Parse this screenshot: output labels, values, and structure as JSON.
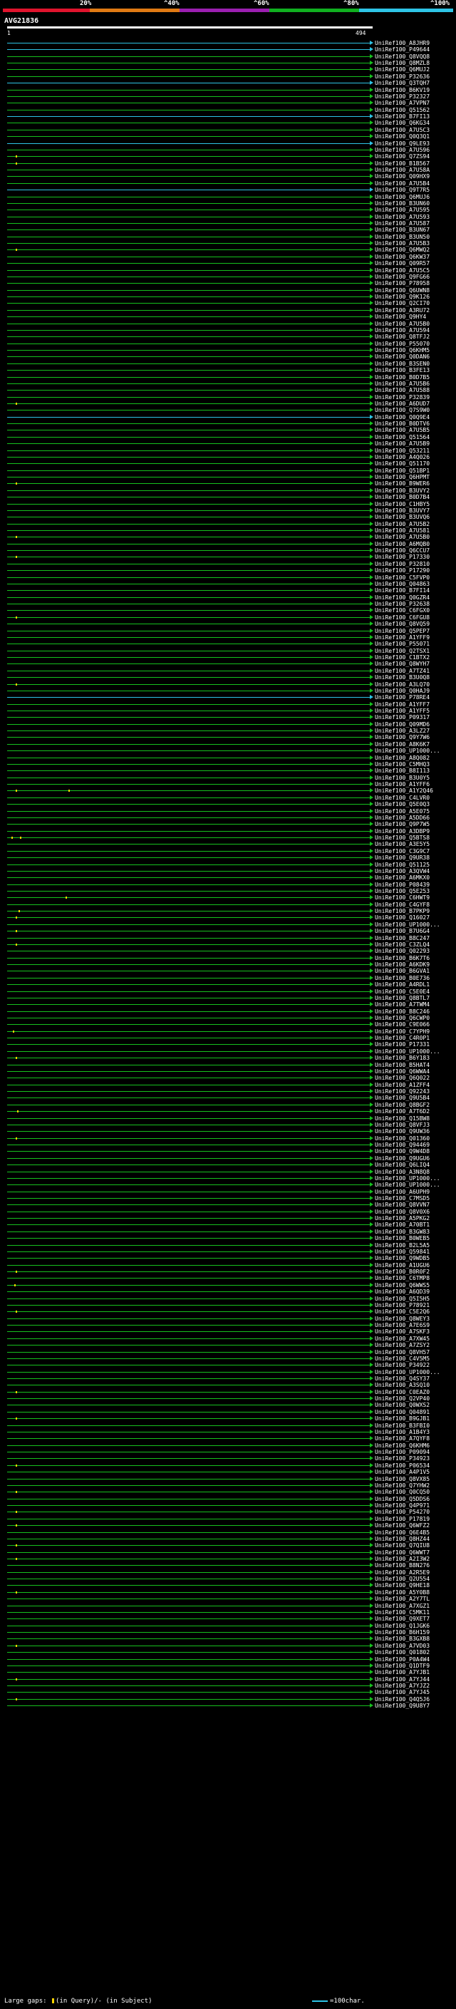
{
  "scale": {
    "labels": [
      "20%",
      "^40%",
      "^60%",
      "^80%",
      "^100%"
    ],
    "colors": [
      "#e0142d",
      "#e07a14",
      "#9b1fb0",
      "#10b020",
      "#2ec4e6"
    ]
  },
  "query": {
    "id": "AVG21836",
    "start": "1",
    "end": "494"
  },
  "colors": {
    "hit_green": "#16c01e",
    "hit_cyan": "#2ec4e6",
    "gap_yellow": "#ffd400"
  },
  "hits": [
    {
      "label": "UniRef100_A8JHR9",
      "color": "cyan"
    },
    {
      "label": "UniRef100_P49644",
      "color": "cyan"
    },
    {
      "label": "UniRef100_Q8VQQ8",
      "color": "green"
    },
    {
      "label": "UniRef100_Q8MZL8",
      "color": "green"
    },
    {
      "label": "UniRef100_Q6MUJ2",
      "color": "green"
    },
    {
      "label": "UniRef100_P32636",
      "color": "green"
    },
    {
      "label": "UniRef100_Q3TQH7",
      "color": "cyan"
    },
    {
      "label": "UniRef100_B6KV19",
      "color": "green"
    },
    {
      "label": "UniRef100_P32327",
      "color": "green"
    },
    {
      "label": "UniRef100_A7VPN7",
      "color": "green"
    },
    {
      "label": "UniRef100_Q51562",
      "color": "green"
    },
    {
      "label": "UniRef100_B7FI13",
      "color": "cyan"
    },
    {
      "label": "UniRef100_Q6KG34",
      "color": "green"
    },
    {
      "label": "UniRef100_A7U5C3",
      "color": "green"
    },
    {
      "label": "UniRef100_Q0Q3Q1",
      "color": "green"
    },
    {
      "label": "UniRef100_Q9LE93",
      "color": "cyan"
    },
    {
      "label": "UniRef100_A7U596",
      "color": "green"
    },
    {
      "label": "UniRef100_Q7ZS94",
      "color": "green"
    },
    {
      "label": "UniRef100_B1B567",
      "color": "green"
    },
    {
      "label": "UniRef100_A7U58A",
      "color": "green"
    },
    {
      "label": "UniRef100_Q09HX9",
      "color": "green"
    },
    {
      "label": "UniRef100_A7U5B4",
      "color": "green"
    },
    {
      "label": "UniRef100_Q9T7R5",
      "color": "cyan"
    },
    {
      "label": "UniRef100_Q6MUJ6",
      "color": "green"
    },
    {
      "label": "UniRef100_B3UN60",
      "color": "green"
    },
    {
      "label": "UniRef100_A7U595",
      "color": "green"
    },
    {
      "label": "UniRef100_A7U593",
      "color": "green"
    },
    {
      "label": "UniRef100_A7U587",
      "color": "green"
    },
    {
      "label": "UniRef100_B3UN67",
      "color": "green"
    },
    {
      "label": "UniRef100_B3UN50",
      "color": "green"
    },
    {
      "label": "UniRef100_A7U5B3",
      "color": "green"
    },
    {
      "label": "UniRef100_Q6MWQ2",
      "color": "green"
    },
    {
      "label": "UniRef100_Q6KW37",
      "color": "green"
    },
    {
      "label": "UniRef100_Q09R57",
      "color": "green"
    },
    {
      "label": "UniRef100_A7U5C5",
      "color": "green"
    },
    {
      "label": "UniRef100_Q9FG66",
      "color": "green"
    },
    {
      "label": "UniRef100_P78958",
      "color": "green"
    },
    {
      "label": "UniRef100_Q6UWN8",
      "color": "green"
    },
    {
      "label": "UniRef100_Q9K126",
      "color": "green"
    },
    {
      "label": "UniRef100_Q2CI70",
      "color": "green"
    },
    {
      "label": "UniRef100_A3RU72",
      "color": "green"
    },
    {
      "label": "UniRef100_Q9HY4",
      "color": "green"
    },
    {
      "label": "UniRef100_A7U5B0",
      "color": "green"
    },
    {
      "label": "UniRef100_A7U594",
      "color": "green"
    },
    {
      "label": "UniRef100_Q8TFJ2",
      "color": "green"
    },
    {
      "label": "UniRef100_P55070",
      "color": "green"
    },
    {
      "label": "UniRef100_Q6KHM5",
      "color": "green"
    },
    {
      "label": "UniRef100_Q0DAN6",
      "color": "green"
    },
    {
      "label": "UniRef100_B3SEN0",
      "color": "green"
    },
    {
      "label": "UniRef100_B3FE13",
      "color": "green"
    },
    {
      "label": "UniRef100_B0D7B5",
      "color": "green"
    },
    {
      "label": "UniRef100_A7U5B6",
      "color": "green"
    },
    {
      "label": "UniRef100_A7U588",
      "color": "green"
    },
    {
      "label": "UniRef100_P32839",
      "color": "green"
    },
    {
      "label": "UniRef100_A6DUD7",
      "color": "green"
    },
    {
      "label": "UniRef100_Q7S9W0",
      "color": "green"
    },
    {
      "label": "UniRef100_Q0Q9E4",
      "color": "cyan"
    },
    {
      "label": "UniRef100_B0DTV6",
      "color": "green"
    },
    {
      "label": "UniRef100_A7U5B5",
      "color": "green"
    },
    {
      "label": "UniRef100_Q51564",
      "color": "green"
    },
    {
      "label": "UniRef100_A7U5B9",
      "color": "green"
    },
    {
      "label": "UniRef100_Q53211",
      "color": "green"
    },
    {
      "label": "UniRef100_A4Q026",
      "color": "green"
    },
    {
      "label": "UniRef100_Q51170",
      "color": "green"
    },
    {
      "label": "UniRef100_Q51BP1",
      "color": "green"
    },
    {
      "label": "UniRef100_Q6HPMT",
      "color": "green"
    },
    {
      "label": "UniRef100_B9WER6",
      "color": "green"
    },
    {
      "label": "UniRef100_B3UVY2",
      "color": "green"
    },
    {
      "label": "UniRef100_B0D7B4",
      "color": "green"
    },
    {
      "label": "UniRef100_C1HBY5",
      "color": "green"
    },
    {
      "label": "UniRef100_B3UVY7",
      "color": "green"
    },
    {
      "label": "UniRef100_B3UVQ6",
      "color": "green"
    },
    {
      "label": "UniRef100_A7U5B2",
      "color": "green"
    },
    {
      "label": "UniRef100_A7U581",
      "color": "green"
    },
    {
      "label": "UniRef100_A7U5B0",
      "color": "green"
    },
    {
      "label": "UniRef100_A6MQB0",
      "color": "green"
    },
    {
      "label": "UniRef100_Q6CCU7",
      "color": "green"
    },
    {
      "label": "UniRef100_P17330",
      "color": "green"
    },
    {
      "label": "UniRef100_P32810",
      "color": "green"
    },
    {
      "label": "UniRef100_P17290",
      "color": "green"
    },
    {
      "label": "UniRef100_C5FVP0",
      "color": "green"
    },
    {
      "label": "UniRef100_Q04863",
      "color": "green"
    },
    {
      "label": "UniRef100_B7FI14",
      "color": "green"
    },
    {
      "label": "UniRef100_Q0GZR4",
      "color": "green"
    },
    {
      "label": "UniRef100_P32638",
      "color": "green"
    },
    {
      "label": "UniRef100_C6FGX0",
      "color": "green"
    },
    {
      "label": "UniRef100_C6FGU8",
      "color": "green"
    },
    {
      "label": "UniRef100_Q8VQ59",
      "color": "green"
    },
    {
      "label": "UniRef100_Q5PEP7",
      "color": "green"
    },
    {
      "label": "UniRef100_A1YFF9",
      "color": "green"
    },
    {
      "label": "UniRef100_P55071",
      "color": "green"
    },
    {
      "label": "UniRef100_Q2TSX1",
      "color": "green"
    },
    {
      "label": "UniRef100_C1BTX2",
      "color": "green"
    },
    {
      "label": "UniRef100_Q8WYH7",
      "color": "green"
    },
    {
      "label": "UniRef100_A7TZ41",
      "color": "green"
    },
    {
      "label": "UniRef100_B3U0Q8",
      "color": "green"
    },
    {
      "label": "UniRef100_A3LQ70",
      "color": "green"
    },
    {
      "label": "UniRef100_Q0HAJ9",
      "color": "green"
    },
    {
      "label": "UniRef100_P78RE4",
      "color": "cyan"
    },
    {
      "label": "UniRef100_A1YFF7",
      "color": "green"
    },
    {
      "label": "UniRef100_A1YFF5",
      "color": "green"
    },
    {
      "label": "UniRef100_P09317",
      "color": "green"
    },
    {
      "label": "UniRef100_Q09MD6",
      "color": "green"
    },
    {
      "label": "UniRef100_A3LZ27",
      "color": "green"
    },
    {
      "label": "UniRef100_Q9Y7W6",
      "color": "green"
    },
    {
      "label": "UniRef100_A8K6K7",
      "color": "green"
    },
    {
      "label": "UniRef100_UP1000...",
      "color": "green"
    },
    {
      "label": "UniRef100_A8Q082",
      "color": "green"
    },
    {
      "label": "UniRef100_C5MHQ3",
      "color": "green"
    },
    {
      "label": "UniRef100_B8I113",
      "color": "green"
    },
    {
      "label": "UniRef100_B3U0Y5",
      "color": "green"
    },
    {
      "label": "UniRef100_A1YFF6",
      "color": "green"
    },
    {
      "label": "UniRef100_A1Y2Q46",
      "color": "green"
    },
    {
      "label": "UniRef100_C4LVR0",
      "color": "green"
    },
    {
      "label": "UniRef100_Q5E0Q3",
      "color": "green"
    },
    {
      "label": "UniRef100_A5E075",
      "color": "green"
    },
    {
      "label": "UniRef100_A5DD66",
      "color": "green"
    },
    {
      "label": "UniRef100_Q9P7W5",
      "color": "green"
    },
    {
      "label": "UniRef100_A3DBP9",
      "color": "green"
    },
    {
      "label": "UniRef100_Q5BTS8",
      "color": "green"
    },
    {
      "label": "UniRef100_A3E5Y5",
      "color": "green"
    },
    {
      "label": "UniRef100_C3G9C7",
      "color": "green"
    },
    {
      "label": "UniRef100_Q9UR38",
      "color": "green"
    },
    {
      "label": "UniRef100_Q51125",
      "color": "green"
    },
    {
      "label": "UniRef100_A3QVW4",
      "color": "green"
    },
    {
      "label": "UniRef100_A6MKX0",
      "color": "green"
    },
    {
      "label": "UniRef100_P08439",
      "color": "green"
    },
    {
      "label": "UniRef100_Q5E253",
      "color": "green"
    },
    {
      "label": "UniRef100_C6HWT9",
      "color": "green"
    },
    {
      "label": "UniRef100_C4GYF8",
      "color": "green"
    },
    {
      "label": "UniRef100_B7PKP9",
      "color": "green"
    },
    {
      "label": "UniRef100_Q16027",
      "color": "green"
    },
    {
      "label": "UniRef100_UP1000...",
      "color": "green"
    },
    {
      "label": "UniRef100_B7U6G4",
      "color": "green"
    },
    {
      "label": "UniRef100_B8C247",
      "color": "green"
    },
    {
      "label": "UniRef100_C3ZLQ4",
      "color": "green"
    },
    {
      "label": "UniRef100_Q02293",
      "color": "green"
    },
    {
      "label": "UniRef100_B6K7T6",
      "color": "green"
    },
    {
      "label": "UniRef100_A6KDK9",
      "color": "green"
    },
    {
      "label": "UniRef100_B6GVA1",
      "color": "green"
    },
    {
      "label": "UniRef100_B0E736",
      "color": "green"
    },
    {
      "label": "UniRef100_A4RDL1",
      "color": "green"
    },
    {
      "label": "UniRef100_C5E0E4",
      "color": "green"
    },
    {
      "label": "UniRef100_Q8BTL7",
      "color": "green"
    },
    {
      "label": "UniRef100_A7TWM4",
      "color": "green"
    },
    {
      "label": "UniRef100_B8C246",
      "color": "green"
    },
    {
      "label": "UniRef100_Q6CWP0",
      "color": "green"
    },
    {
      "label": "UniRef100_C9E066",
      "color": "green"
    },
    {
      "label": "UniRef100_C7YPH9",
      "color": "green"
    },
    {
      "label": "UniRef100_C4R0P1",
      "color": "green"
    },
    {
      "label": "UniRef100_P17331",
      "color": "green"
    },
    {
      "label": "UniRef100_UP1000...",
      "color": "green"
    },
    {
      "label": "UniRef100_B6Y183",
      "color": "green"
    },
    {
      "label": "UniRef100_B5HAT4",
      "color": "green"
    },
    {
      "label": "UniRef100_Q6WWA4",
      "color": "green"
    },
    {
      "label": "UniRef100_Q6Q022",
      "color": "green"
    },
    {
      "label": "UniRef100_A1ZFF4",
      "color": "green"
    },
    {
      "label": "UniRef100_Q92243",
      "color": "green"
    },
    {
      "label": "UniRef100_Q9U5B4",
      "color": "green"
    },
    {
      "label": "UniRef100_Q8BGF2",
      "color": "green"
    },
    {
      "label": "UniRef100_A7T6D2",
      "color": "green"
    },
    {
      "label": "UniRef100_Q15BW8",
      "color": "green"
    },
    {
      "label": "UniRef100_Q8VFJ3",
      "color": "green"
    },
    {
      "label": "UniRef100_Q9UW36",
      "color": "green"
    },
    {
      "label": "UniRef100_Q01360",
      "color": "green"
    },
    {
      "label": "UniRef100_Q94469",
      "color": "green"
    },
    {
      "label": "UniRef100_Q9W4D8",
      "color": "green"
    },
    {
      "label": "UniRef100_Q9UGU6",
      "color": "green"
    },
    {
      "label": "UniRef100_Q6LIQ4",
      "color": "green"
    },
    {
      "label": "UniRef100_A3N8Q8",
      "color": "green"
    },
    {
      "label": "UniRef100_UP1000...",
      "color": "green"
    },
    {
      "label": "UniRef100_UP1000...",
      "color": "green"
    },
    {
      "label": "UniRef100_A6UPH9",
      "color": "green"
    },
    {
      "label": "UniRef100_C7MSD5",
      "color": "green"
    },
    {
      "label": "UniRef100_Q8VVN7",
      "color": "green"
    },
    {
      "label": "UniRef100_Q8V0X6",
      "color": "green"
    },
    {
      "label": "UniRef100_A5PKG2",
      "color": "green"
    },
    {
      "label": "UniRef100_A70BT1",
      "color": "green"
    },
    {
      "label": "UniRef100_B3GW83",
      "color": "green"
    },
    {
      "label": "UniRef100_B0WEB5",
      "color": "green"
    },
    {
      "label": "UniRef100_B2L5A5",
      "color": "green"
    },
    {
      "label": "UniRef100_Q59841",
      "color": "green"
    },
    {
      "label": "UniRef100_Q9WDB5",
      "color": "green"
    },
    {
      "label": "UniRef100_A1UGU6",
      "color": "green"
    },
    {
      "label": "UniRef100_B0R0F2",
      "color": "green"
    },
    {
      "label": "UniRef100_C6TMP8",
      "color": "green"
    },
    {
      "label": "UniRef100_Q6WWS5",
      "color": "green"
    },
    {
      "label": "UniRef100_A6QD39",
      "color": "green"
    },
    {
      "label": "UniRef100_Q5I5H5",
      "color": "green"
    },
    {
      "label": "UniRef100_P78921",
      "color": "green"
    },
    {
      "label": "UniRef100_C5E2Q6",
      "color": "green"
    },
    {
      "label": "UniRef100_Q8WEY3",
      "color": "green"
    },
    {
      "label": "UniRef100_A7E6S9",
      "color": "green"
    },
    {
      "label": "UniRef100_A7SKF3",
      "color": "green"
    },
    {
      "label": "UniRef100_A7XW45",
      "color": "green"
    },
    {
      "label": "UniRef100_A7ZSY2",
      "color": "green"
    },
    {
      "label": "UniRef100_Q8VH57",
      "color": "green"
    },
    {
      "label": "UniRef100_C4V5M5",
      "color": "green"
    },
    {
      "label": "UniRef100_P34922",
      "color": "green"
    },
    {
      "label": "UniRef100_UP1000...",
      "color": "green"
    },
    {
      "label": "UniRef100_Q4SY37",
      "color": "green"
    },
    {
      "label": "UniRef100_A3SQ10",
      "color": "green"
    },
    {
      "label": "UniRef100_C0EAZ0",
      "color": "green"
    },
    {
      "label": "UniRef100_Q2VP40",
      "color": "green"
    },
    {
      "label": "UniRef100_Q0WXS2",
      "color": "green"
    },
    {
      "label": "UniRef100_Q04891",
      "color": "green"
    },
    {
      "label": "UniRef100_B9GJB1",
      "color": "green"
    },
    {
      "label": "UniRef100_B3FBI0",
      "color": "green"
    },
    {
      "label": "UniRef100_A1B4Y3",
      "color": "green"
    },
    {
      "label": "UniRef100_A7QYF8",
      "color": "green"
    },
    {
      "label": "UniRef100_Q6KHM6",
      "color": "green"
    },
    {
      "label": "UniRef100_P09094",
      "color": "green"
    },
    {
      "label": "UniRef100_P34923",
      "color": "green"
    },
    {
      "label": "UniRef100_P06534",
      "color": "green"
    },
    {
      "label": "UniRef100_A4P1V5",
      "color": "green"
    },
    {
      "label": "UniRef100_Q8VX85",
      "color": "green"
    },
    {
      "label": "UniRef100_Q7YHW2",
      "color": "green"
    },
    {
      "label": "UniRef100_Q0CQ50",
      "color": "green"
    },
    {
      "label": "UniRef100_Q5DDS6",
      "color": "green"
    },
    {
      "label": "UniRef100_Q4P971",
      "color": "green"
    },
    {
      "label": "UniRef100_P54270",
      "color": "green"
    },
    {
      "label": "UniRef100_P17819",
      "color": "green"
    },
    {
      "label": "UniRef100_Q6WFZ2",
      "color": "green"
    },
    {
      "label": "UniRef100_Q6E4B5",
      "color": "green"
    },
    {
      "label": "UniRef100_Q8HZ44",
      "color": "green"
    },
    {
      "label": "UniRef100_Q7QIU8",
      "color": "green"
    },
    {
      "label": "UniRef100_Q6WWT7",
      "color": "green"
    },
    {
      "label": "UniRef100_A2I3W2",
      "color": "green"
    },
    {
      "label": "UniRef100_B8N276",
      "color": "green"
    },
    {
      "label": "UniRef100_A2R5E9",
      "color": "green"
    },
    {
      "label": "UniRef100_Q2U554",
      "color": "green"
    },
    {
      "label": "UniRef100_Q9HE18",
      "color": "green"
    },
    {
      "label": "UniRef100_A5Y0B8",
      "color": "green"
    },
    {
      "label": "UniRef100_A2Y7TL",
      "color": "green"
    },
    {
      "label": "UniRef100_A7XGZ1",
      "color": "green"
    },
    {
      "label": "UniRef100_C5MK11",
      "color": "green"
    },
    {
      "label": "UniRef100_Q9XET7",
      "color": "green"
    },
    {
      "label": "UniRef100_Q1JGK6",
      "color": "green"
    },
    {
      "label": "UniRef100_B6H159",
      "color": "green"
    },
    {
      "label": "UniRef100_B3GXB8",
      "color": "green"
    },
    {
      "label": "UniRef100_A7VD03",
      "color": "green"
    },
    {
      "label": "UniRef100_Q01802",
      "color": "green"
    },
    {
      "label": "UniRef100_P0A4W4",
      "color": "green"
    },
    {
      "label": "UniRef100_Q1DTF9",
      "color": "green"
    },
    {
      "label": "UniRef100_A7YJB1",
      "color": "green"
    },
    {
      "label": "UniRef100_A7YJ44",
      "color": "green"
    },
    {
      "label": "UniRef100_A7YJZ2",
      "color": "green"
    },
    {
      "label": "UniRef100_A7YJ45",
      "color": "green"
    },
    {
      "label": "UniRef100_Q4Q5J6",
      "color": "green"
    },
    {
      "label": "UniRef100_Q9U8Y7",
      "color": "green"
    }
  ],
  "legend": {
    "gaps_text_before": "Large gaps: ",
    "gaps_text_after": "(in Query)/",
    "gaps_subject": "- (in Subject)",
    "scale_text": "=100char."
  }
}
